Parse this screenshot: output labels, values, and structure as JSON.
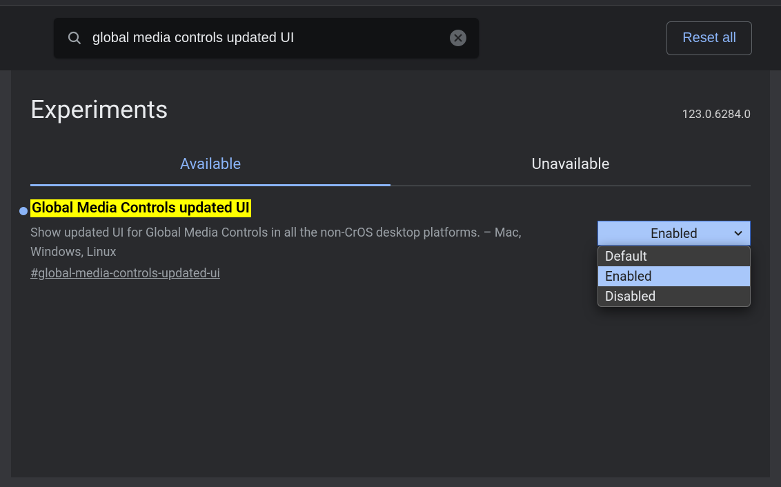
{
  "search": {
    "value": "global media controls updated UI"
  },
  "header": {
    "reset_label": "Reset all",
    "title": "Experiments",
    "version": "123.0.6284.0"
  },
  "tabs": {
    "available": "Available",
    "unavailable": "Unavailable"
  },
  "flag": {
    "title": "Global Media Controls updated UI",
    "description": "Show updated UI for Global Media Controls in all the non-CrOS desktop platforms. – Mac, Windows, Linux",
    "hash": "#global-media-controls-updated-ui",
    "selected": "Enabled",
    "options": [
      "Default",
      "Enabled",
      "Disabled"
    ]
  }
}
